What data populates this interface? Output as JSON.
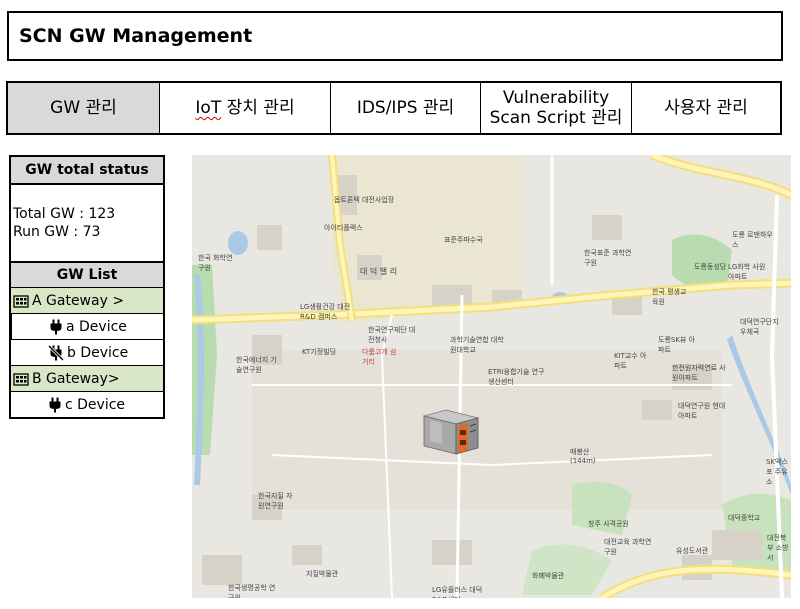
{
  "header": {
    "title": "SCN GW Management"
  },
  "tabs": [
    {
      "label": "GW 관리",
      "active": true
    },
    {
      "label_prefix": "IoT",
      "label_rest": " 장치 관리",
      "active": false
    },
    {
      "label": "IDS/IPS 관리",
      "active": false
    },
    {
      "label_line1": "Vulnerability",
      "label_line2": "Scan Script 관리",
      "active": false
    },
    {
      "label": "사용자 관리",
      "active": false
    }
  ],
  "status": {
    "heading": "GW total status",
    "total": "Total GW : 123",
    "run": "Run GW : 73"
  },
  "gw_list": {
    "heading": "GW List",
    "gateways": [
      {
        "label": "A Gateway >",
        "devices": [
          {
            "label": "a Device",
            "connected": true
          },
          {
            "label": "b Device",
            "connected": false
          }
        ]
      },
      {
        "label": "B Gateway>",
        "devices": [
          {
            "label": "c Device",
            "connected": true
          }
        ]
      }
    ]
  },
  "map": {
    "labels": [
      "옵트론텍 대전사업장",
      "아이티플렉스",
      "한국 화학연구원",
      "대 덕 밸 리",
      "표준주파수국",
      "한국표준 과학연구원",
      "도룡 로덴하우스",
      "도룡동성당",
      "LG화학 사원아파트",
      "LG생활건강 대전R&D 캠퍼스",
      "한국연구재단 대전청사",
      "과학기술연합 대학원대학교",
      "한국 평생교육원",
      "대덕연구단지 우체국",
      "도룡SK뷰 아파트",
      "KT기정빌딩",
      "다룸고개 삼거리",
      "한국에너지 기술연구원",
      "KIT교수 아파트",
      "한전원자력연료 사원아파트",
      "ETRI융합기술 연구생산센터",
      "대덕연구원 현대아파트",
      "매봉산 (144m)",
      "SK엑스포 주유소",
      "한국지질 자원연구원",
      "창주 사격공원",
      "대덕중학교",
      "대전교육 과학연구원",
      "유성도서관",
      "대전북부 소방서",
      "지질박물관",
      "화폐박물관",
      "한국생명공학 연구원",
      "LG유플러스 대덕R&D센터"
    ]
  }
}
